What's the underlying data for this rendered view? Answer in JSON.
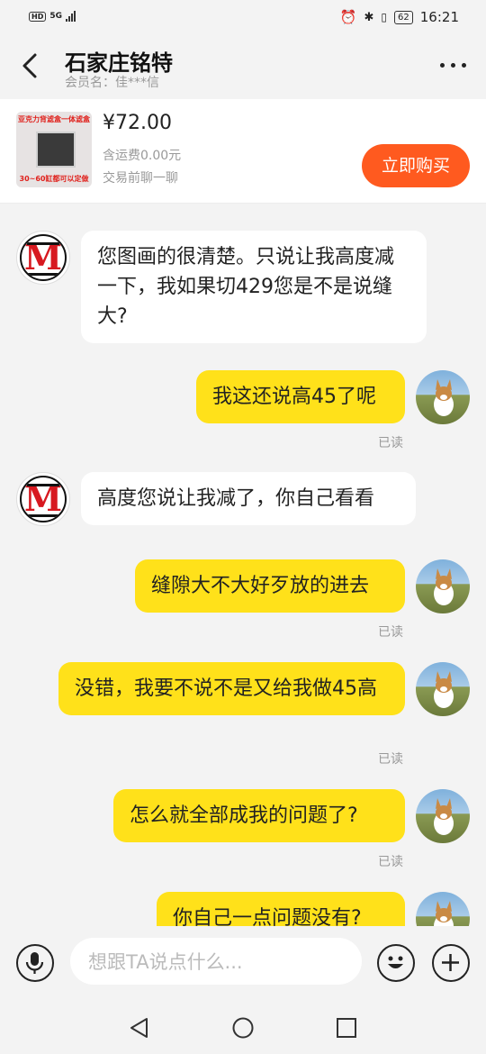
{
  "status_bar": {
    "hd": "HD",
    "network": "5G",
    "battery": "62",
    "time": "16:21"
  },
  "header": {
    "title": "石家庄铭特",
    "subtitle": "会员名：佳***信"
  },
  "product": {
    "thumb_top_text": "亚克力背滤盒一体滤盒",
    "thumb_bottom_text": "30~60缸都可以定做",
    "price": "¥72.00",
    "shipping": "含运费0.00元",
    "hint": "交易前聊一聊",
    "buy_label": "立即购买"
  },
  "messages": [
    {
      "side": "in",
      "text": "您图画的很清楚。只说让我高度减一下，我如果切429您是不是说缝大?"
    },
    {
      "side": "out",
      "text": "我这还说高45了呢",
      "status": "已读"
    },
    {
      "side": "in",
      "text": "高度您说让我减了，你自己看看"
    },
    {
      "side": "out",
      "text": "缝隙大不大好歹放的进去",
      "status": "已读"
    },
    {
      "side": "out",
      "text": "没错，我要不说不是又给我做45高",
      "status": "已读"
    },
    {
      "side": "out",
      "text": "怎么就全部成我的问题了?",
      "status": "已读"
    },
    {
      "side": "out",
      "text": "你自己一点问题没有?"
    }
  ],
  "input": {
    "placeholder": "想跟TA说点什么..."
  },
  "colors": {
    "outgoing_bubble": "#ffe11a",
    "incoming_bubble": "#ffffff",
    "buy_button": "#ff5a1f",
    "background": "#f3f3f3"
  },
  "icons": {
    "back": "chevron-left-icon",
    "more": "more-dots-icon",
    "voice": "microphone-icon",
    "emoji": "emoji-icon",
    "add": "plus-icon",
    "nav_back": "triangle-back-icon",
    "nav_home": "circle-home-icon",
    "nav_recent": "square-recent-icon"
  }
}
